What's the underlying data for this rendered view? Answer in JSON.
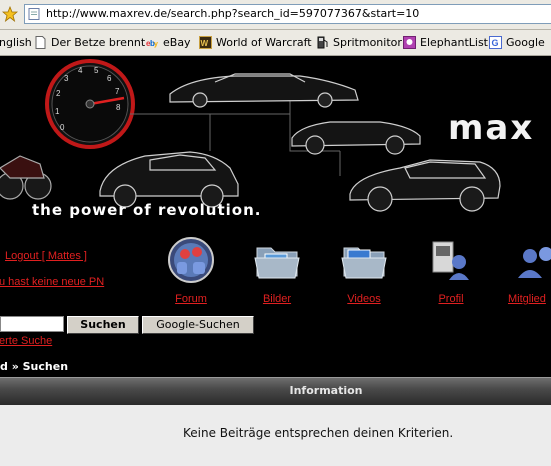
{
  "browser": {
    "url": "http://www.maxrev.de/search.php?search_id=597077367&start=10"
  },
  "bookmarks": [
    {
      "label": "nglish",
      "icon": "page-icon"
    },
    {
      "label": "Der Betze brennt",
      "icon": "page-icon"
    },
    {
      "label": "eBay",
      "icon": "ebay-icon"
    },
    {
      "label": "World of Warcraft",
      "icon": "wow-icon"
    },
    {
      "label": "Spritmonitor",
      "icon": "fuel-icon"
    },
    {
      "label": "ElephantList",
      "icon": "elephant-icon"
    },
    {
      "label": "Google",
      "icon": "google-icon"
    }
  ],
  "banner": {
    "slogan": "the power of revolution.",
    "brand": "max"
  },
  "user": {
    "logout": "Logout [ Mattes ]",
    "pm_notice": "u hast keine neue PN"
  },
  "nav": [
    {
      "label": "Forum",
      "icon": "forum-icon"
    },
    {
      "label": "Bilder",
      "icon": "folder-images-icon"
    },
    {
      "label": "Videos",
      "icon": "folder-videos-icon"
    },
    {
      "label": "Profil",
      "icon": "profile-icon"
    },
    {
      "label": "Mitglied",
      "icon": "members-icon"
    }
  ],
  "search": {
    "input_value": "",
    "submit_label": "Suchen",
    "google_label": "Google-Suchen",
    "advanced_link": "erte Suche"
  },
  "breadcrumb": "d » Suchen",
  "info": {
    "title": "Information",
    "message": "Keine Beiträge entsprechen deinen Kriterien."
  },
  "colors": {
    "link": "#e02020",
    "background": "#000000",
    "panel": "#ececec"
  }
}
